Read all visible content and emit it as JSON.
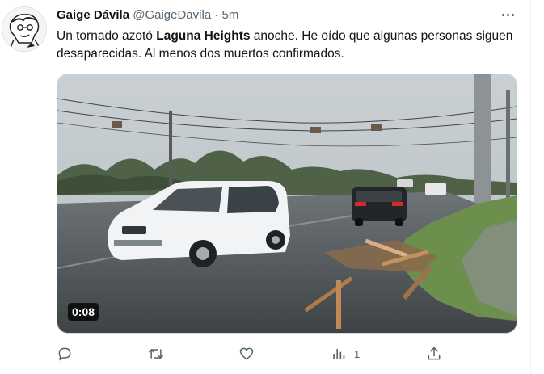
{
  "tweet": {
    "display_name": "Gaige Dávila",
    "handle": "@GaigeDavila",
    "separator": "·",
    "time": "5m",
    "text_part1": "Un tornado azotó ",
    "text_bold": "Laguna Heights",
    "text_part2": " anoche. He oído que algunas personas siguen desaparecidas. Al menos dos muertos confirmados."
  },
  "video": {
    "duration": "0:08"
  },
  "actions": {
    "reply_icon": "reply-icon",
    "retweet_icon": "retweet-icon",
    "like_icon": "heart-icon",
    "views_icon": "views-icon",
    "views_count": "1",
    "share_icon": "share-icon"
  },
  "colors": {
    "text": "#0f1419",
    "secondary": "#536471",
    "border": "#cfd9de"
  }
}
